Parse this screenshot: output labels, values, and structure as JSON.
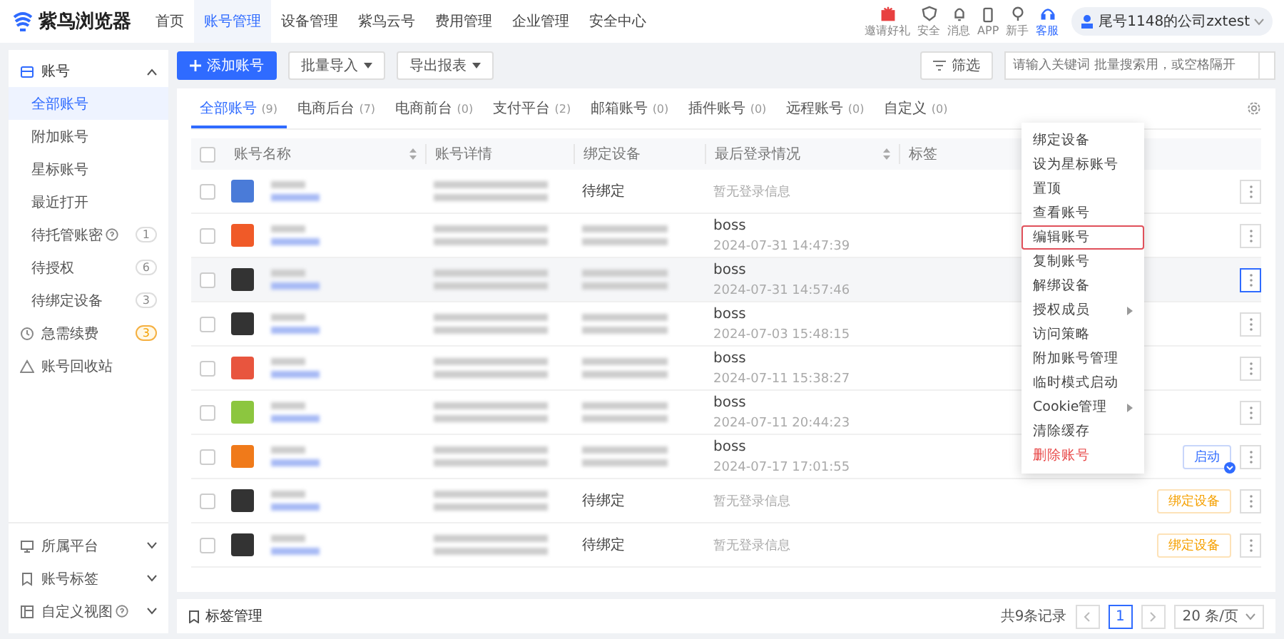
{
  "top_nav": {
    "logo": "紫鸟浏览器",
    "items": [
      {
        "label": "首页",
        "selected": false
      },
      {
        "label": "账号管理",
        "selected": true
      },
      {
        "label": "设备管理",
        "selected": false
      },
      {
        "label": "紫鸟云号",
        "selected": false
      },
      {
        "label": "费用管理",
        "selected": false
      },
      {
        "label": "企业管理",
        "selected": false
      },
      {
        "label": "安全中心",
        "selected": false
      }
    ],
    "tools": [
      {
        "kind": "gift",
        "label": "邀请好礼",
        "selected": false
      },
      {
        "kind": "shield",
        "label": "安全",
        "selected": false
      },
      {
        "kind": "bell",
        "label": "消息",
        "selected": false
      },
      {
        "kind": "phone",
        "label": "APP",
        "selected": false
      },
      {
        "kind": "bulb",
        "label": "新手",
        "selected": false
      },
      {
        "kind": "headset",
        "label": "客服",
        "selected": true
      }
    ],
    "user": "尾号1148的公司zxtest"
  },
  "sidebar": {
    "group": {
      "label": "账号",
      "expanded": true,
      "children": [
        {
          "label": "全部账号",
          "selected": true
        },
        {
          "label": "附加账号",
          "selected": false
        },
        {
          "label": "星标账号",
          "selected": false
        },
        {
          "label": "最近打开",
          "selected": false
        },
        {
          "label": "待托管账密",
          "help": true,
          "count": "1",
          "selected": false
        },
        {
          "label": "待授权",
          "count": "6",
          "selected": false
        },
        {
          "label": "待绑定设备",
          "count": "3",
          "selected": false
        }
      ]
    },
    "items": [
      {
        "kind": "renew",
        "label": "急需续费",
        "count": "3"
      },
      {
        "kind": "trash",
        "label": "账号回收站"
      }
    ],
    "sections": [
      {
        "kind": "monitor",
        "label": "所属平台",
        "expanded": false
      },
      {
        "kind": "tag",
        "label": "账号标签",
        "expanded": false
      },
      {
        "kind": "layout",
        "label": "自定义视图",
        "help": true,
        "expanded": false
      }
    ]
  },
  "toolbar": {
    "add": "添加账号",
    "import": "批量导入",
    "export": "导出报表",
    "filter": "筛选",
    "search": {
      "placeholder": "请输入关键词 批量搜索用，或空格隔开"
    }
  },
  "tabs": [
    {
      "label": "全部账号",
      "count": "(9)",
      "selected": true
    },
    {
      "label": "电商后台",
      "count": "(7)",
      "selected": false
    },
    {
      "label": "电商前台",
      "count": "(0)",
      "selected": false
    },
    {
      "label": "支付平台",
      "count": "(2)",
      "selected": false
    },
    {
      "label": "邮箱账号",
      "count": "(0)",
      "selected": false
    },
    {
      "label": "插件账号",
      "count": "(0)",
      "selected": false
    },
    {
      "label": "远程账号",
      "count": "(0)",
      "selected": false
    },
    {
      "label": "自定义",
      "count": "(0)",
      "selected": false
    }
  ],
  "table": {
    "select_all_checked": false,
    "columns": [
      "账号名称",
      "账号详情",
      "绑定设备",
      "最后登录情况",
      "标签"
    ],
    "rows": [
      {
        "color": "#4a7bd8",
        "checked": false,
        "selected": false,
        "device": "待绑定",
        "login_user": null,
        "login_time": "暂无登录信息",
        "action": null
      },
      {
        "color": "#f05a28",
        "checked": false,
        "selected": false,
        "device": null,
        "login_user": "boss",
        "login_time": "2024-07-31 14:47:39",
        "action": null
      },
      {
        "color": "#333333",
        "checked": false,
        "selected": true,
        "device": null,
        "login_user": "boss",
        "login_time": "2024-07-31 14:57:46",
        "action": null
      },
      {
        "color": "#333333",
        "checked": false,
        "selected": false,
        "device": null,
        "login_user": "boss",
        "login_time": "2024-07-03 15:48:15",
        "action": null
      },
      {
        "color": "#e8553e",
        "checked": false,
        "selected": false,
        "device": null,
        "login_user": "boss",
        "login_time": "2024-07-11 15:38:27",
        "action": null
      },
      {
        "color": "#8cc63f",
        "checked": false,
        "selected": false,
        "device": null,
        "login_user": "boss",
        "login_time": "2024-07-11 20:44:23",
        "action": null
      },
      {
        "color": "#f07a1a",
        "checked": false,
        "selected": false,
        "device": null,
        "login_user": "boss",
        "login_time": "2024-07-17 17:01:55",
        "action": {
          "kind": "launch",
          "label": "启动"
        }
      },
      {
        "color": "#333333",
        "checked": false,
        "selected": false,
        "device": "待绑定",
        "login_user": null,
        "login_time": "暂无登录信息",
        "action": {
          "kind": "bind",
          "label": "绑定设备"
        }
      },
      {
        "color": "#333333",
        "checked": false,
        "selected": false,
        "device": "待绑定",
        "login_user": null,
        "login_time": "暂无登录信息",
        "action": {
          "kind": "bind",
          "label": "绑定设备"
        }
      }
    ]
  },
  "menu": [
    {
      "label": "绑定设备",
      "kind": "normal",
      "selected": false
    },
    {
      "label": "设为星标账号",
      "kind": "normal",
      "selected": false
    },
    {
      "label": "置顶",
      "kind": "normal",
      "selected": false
    },
    {
      "label": "查看账号",
      "kind": "normal",
      "selected": false
    },
    {
      "label": "编辑账号",
      "kind": "normal",
      "selected": true
    },
    {
      "label": "复制账号",
      "kind": "normal",
      "selected": false
    },
    {
      "label": "解绑设备",
      "kind": "normal",
      "selected": false
    },
    {
      "label": "授权成员",
      "kind": "submenu",
      "selected": false
    },
    {
      "label": "访问策略",
      "kind": "normal",
      "selected": false
    },
    {
      "label": "附加账号管理",
      "kind": "normal",
      "selected": false
    },
    {
      "label": "临时模式启动",
      "kind": "normal",
      "selected": false
    },
    {
      "label": "Cookie管理",
      "kind": "submenu",
      "selected": false
    },
    {
      "label": "清除缓存",
      "kind": "normal",
      "selected": false
    },
    {
      "label": "删除账号",
      "kind": "danger",
      "selected": false
    }
  ],
  "footer": {
    "tag_manage": "标签管理",
    "total": "共9条记录",
    "page": "1",
    "page_size": "20 条/页"
  }
}
